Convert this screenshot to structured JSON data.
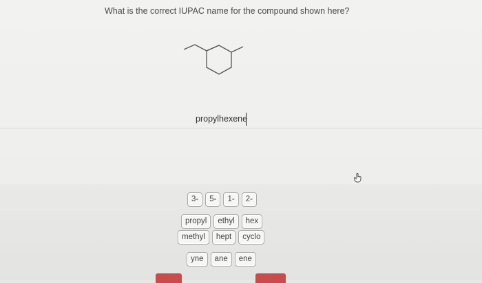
{
  "question": "What is the correct IUPAC name for the compound shown here?",
  "answer_value": "propylhexene",
  "prefix_tiles": [
    "3-",
    "5-",
    "1-",
    "2-"
  ],
  "root_tiles_row1": [
    "propyl",
    "ethyl",
    "hex"
  ],
  "root_tiles_row2": [
    "methyl",
    "hept",
    "cyclo"
  ],
  "suffix_tiles": [
    "yne",
    "ane",
    "ene"
  ]
}
